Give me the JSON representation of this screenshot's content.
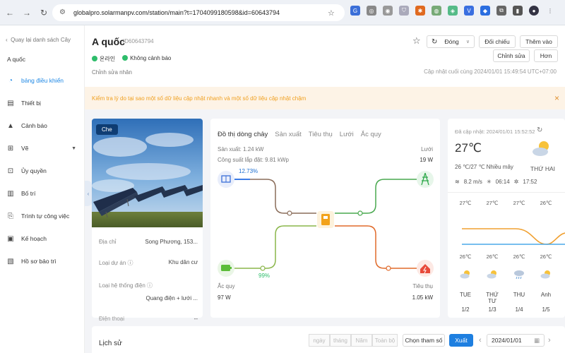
{
  "browser": {
    "url": "globalpro.solarmanpv.com/station/main?t=1704099180598&id=60643794"
  },
  "sidebar": {
    "back_label": "Quay lại danh sách Cây",
    "site_name": "A quốc",
    "items": [
      {
        "label": "bảng điều khiển",
        "icon": "dashboard-icon"
      },
      {
        "label": "Thiết bị",
        "icon": "device-icon"
      },
      {
        "label": "Cảnh báo",
        "icon": "warning-icon"
      },
      {
        "label": "Vẽ",
        "icon": "draw-icon"
      },
      {
        "label": "Ủy quyền",
        "icon": "authorize-icon"
      },
      {
        "label": "Bố trí",
        "icon": "layout-icon"
      },
      {
        "label": "Trình tự công việc",
        "icon": "workflow-icon"
      },
      {
        "label": "Kế hoạch",
        "icon": "plan-icon"
      },
      {
        "label": "Hồ sơ bảo trì",
        "icon": "maintenance-icon"
      }
    ]
  },
  "header": {
    "title": "A quốc",
    "station_id": "ID60643794",
    "status_online": "온라인",
    "status_alert": "Không cảnh báo",
    "edit_person": "Chỉnh sửa nhân",
    "refresh_label": "Đóng",
    "compare_label": "Đối chiếu",
    "add_label": "Thêm vào",
    "edit_label": "Chỉnh sửa",
    "more_label": "Hơn",
    "updated": "Cập nhật cuối cùng 2024/01/01 15:49:54 UTC+07:00"
  },
  "notice": "Kiểm tra lý do tại sao một số dữ liệu cập nhật nhanh và một số dữ liệu cập nhật chậm",
  "photo_card": {
    "badge": "Che",
    "rows": [
      {
        "k": "Địa chỉ",
        "v": "Song Phương, 153..."
      },
      {
        "k": "Loại dự án ⓘ",
        "v": "Khu dân cư"
      },
      {
        "k": "Loại hệ thống điện ⓘ",
        "v": ""
      },
      {
        "k": "",
        "v": "Quang điện + lưới ..."
      },
      {
        "k": "Điện thoại",
        "v": "--"
      }
    ]
  },
  "flow": {
    "tabs": [
      "Đồ thị dòng chảy",
      "Sản xuất",
      "Tiêu thụ",
      "Lưới",
      "Ắc quy"
    ],
    "production": "Sản xuất: 1.24 kW",
    "capacity": "Công suất lắp đặt: 9.81 kWp",
    "pv_percent": "12.73%",
    "grid_label": "Lưới",
    "grid_value": "19 W",
    "battery_label": "Ắc quy",
    "battery_value": "97 W",
    "battery_percent": "99%",
    "consumption_label": "Tiêu thụ",
    "consumption_value": "1.05 kW"
  },
  "weather": {
    "updated": "Đã cập nhật: 2024/01/01 15:52:52",
    "temp": "27℃",
    "range": "26 ℃/27 ℃ Nhiều mây",
    "day": "THỨ HAI",
    "wind": "8.2 m/s",
    "sunrise": "06:14",
    "sunset": "17:52",
    "highs": [
      "27℃",
      "27℃",
      "27℃",
      "26℃"
    ],
    "lows": [
      "26℃",
      "26℃",
      "26℃",
      "26℃"
    ],
    "days": [
      "TUE",
      "THỨ TƯ",
      "THU",
      "Anh"
    ],
    "dates": [
      "1/2",
      "1/3",
      "1/4",
      "1/5"
    ]
  },
  "history": {
    "title": "Lịch sử",
    "segments": [
      "ngày",
      "tháng",
      "Năm",
      "Toàn bộ"
    ],
    "select_params": "Chọn tham số",
    "export": "Xuất",
    "date": "2024/01/01"
  }
}
